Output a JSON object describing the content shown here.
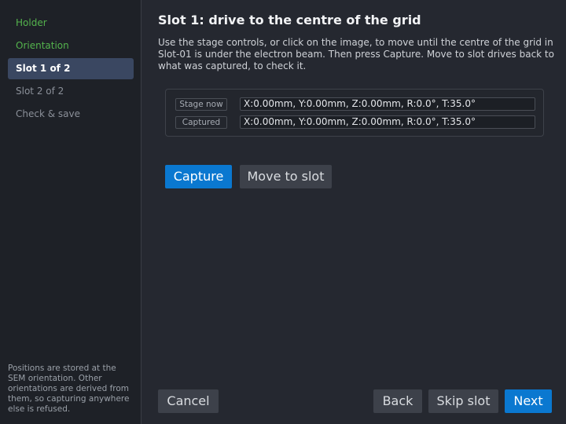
{
  "sidebar": {
    "steps": [
      {
        "label": "Holder",
        "state": "done"
      },
      {
        "label": "Orientation",
        "state": "done"
      },
      {
        "label": "Slot 1 of 2",
        "state": "active"
      },
      {
        "label": "Slot 2 of 2",
        "state": "pending"
      },
      {
        "label": "Check & save",
        "state": "pending"
      }
    ],
    "note": "Positions are stored at the SEM orientation. Other orientations are derived from them, so capturing anywhere else is refused."
  },
  "main": {
    "title": "Slot 1: drive to the centre of the grid",
    "description": "Use the stage controls, or click on the image, to move until the centre of the grid in Slot-01 is under the electron beam. Then press Capture. Move to slot drives back to what was captured, to check it.",
    "positions": {
      "stage_now_label": "Stage now",
      "stage_now_value": "X:0.00mm, Y:0.00mm, Z:0.00mm, R:0.0°, T:35.0°",
      "captured_label": "Captured",
      "captured_value": "X:0.00mm, Y:0.00mm, Z:0.00mm, R:0.0°, T:35.0°"
    },
    "actions": {
      "capture_label": "Capture",
      "move_label": "Move to slot"
    }
  },
  "footer": {
    "cancel_label": "Cancel",
    "back_label": "Back",
    "skip_label": "Skip slot",
    "next_label": "Next"
  },
  "colors": {
    "accent": "#0a78d0",
    "done_step": "#54b44d",
    "active_step_bg": "#3a4761",
    "background": "#252830",
    "sidebar_bg": "#1e2127"
  }
}
